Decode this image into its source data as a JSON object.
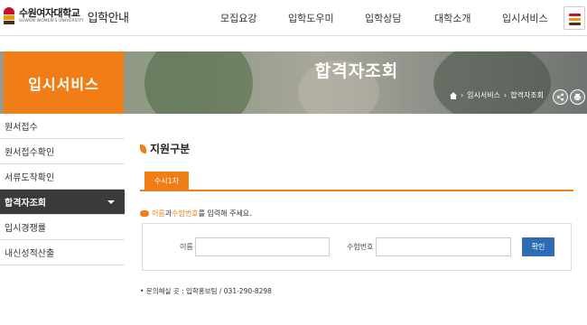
{
  "header": {
    "logo_kr": "수원여자대학교",
    "logo_en": "SUWON WOMEN'S UNIVERSITY",
    "logo_sub": "입학안내",
    "nav": [
      "모집요강",
      "입학도우미",
      "입학상담",
      "대학소개",
      "입시서비스"
    ],
    "menu_colors": [
      "#c8102e",
      "#f39800",
      "#4b2c20"
    ]
  },
  "hero": {
    "section": "입시서비스",
    "title": "합격자조회",
    "breadcrumb": [
      "입시서비스",
      "합격자조회"
    ]
  },
  "sidebar": {
    "items": [
      {
        "label": "원서접수",
        "active": false
      },
      {
        "label": "원서접수확인",
        "active": false
      },
      {
        "label": "서류도착확인",
        "active": false
      },
      {
        "label": "합격자조회",
        "active": true
      },
      {
        "label": "입시경쟁률",
        "active": false
      },
      {
        "label": "내신성적산출",
        "active": false
      }
    ]
  },
  "main": {
    "section_title": "지원구분",
    "tab": "수시1차",
    "notice": {
      "part1": "이름",
      "part2": "과 ",
      "part3": "수험번호",
      "part4": "를 입력해 주세요."
    },
    "form": {
      "name_label": "이름",
      "exam_label": "수험번호",
      "name_value": "",
      "exam_value": "",
      "submit": "확인"
    },
    "contact": "• 문의해실 곳 : 입학홍보팀 / 031-290-8298"
  },
  "colors": {
    "accent": "#f07d15",
    "active_bg": "#3a3a3a",
    "button": "#2e6db4"
  }
}
